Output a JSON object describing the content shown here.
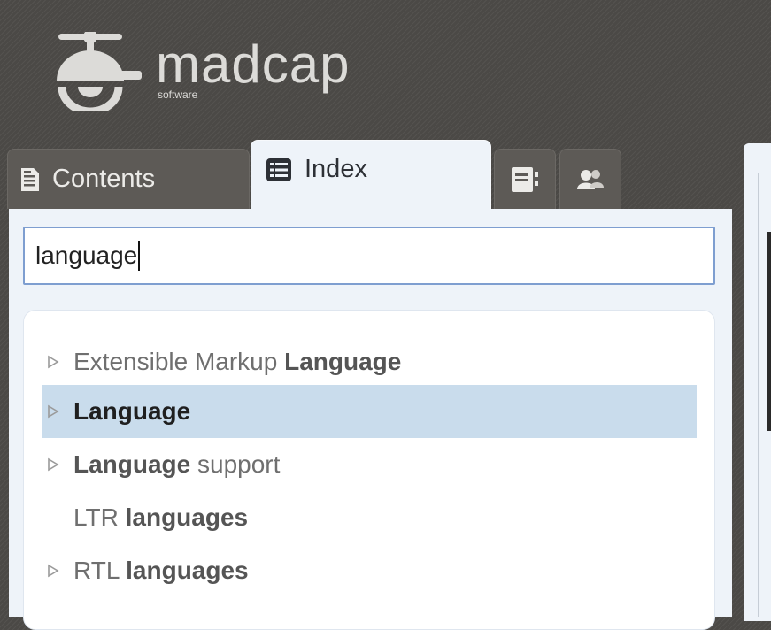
{
  "brand": {
    "name": "madcap",
    "tagline": "software"
  },
  "tabs": {
    "contents_label": "Contents",
    "index_label": "Index",
    "glossary_icon": "glossary-icon",
    "community_icon": "community-icon"
  },
  "search": {
    "value": "language"
  },
  "index_items": [
    {
      "before": "Extensible Markup ",
      "match": "Language",
      "after": "",
      "expandable": true,
      "selected": false
    },
    {
      "before": "",
      "match": "Language",
      "after": "",
      "expandable": true,
      "selected": true
    },
    {
      "before": "",
      "match": "Language",
      "after": " support",
      "expandable": true,
      "selected": false
    },
    {
      "before": "LTR ",
      "match": "languages",
      "after": "",
      "expandable": false,
      "selected": false
    },
    {
      "before": "RTL ",
      "match": "languages",
      "after": "",
      "expandable": true,
      "selected": false
    }
  ],
  "colors": {
    "header_bg": "#4b4946",
    "panel_bg": "#eef3f9",
    "selected_row": "#c9dcec",
    "search_border": "#7e9ed0"
  }
}
